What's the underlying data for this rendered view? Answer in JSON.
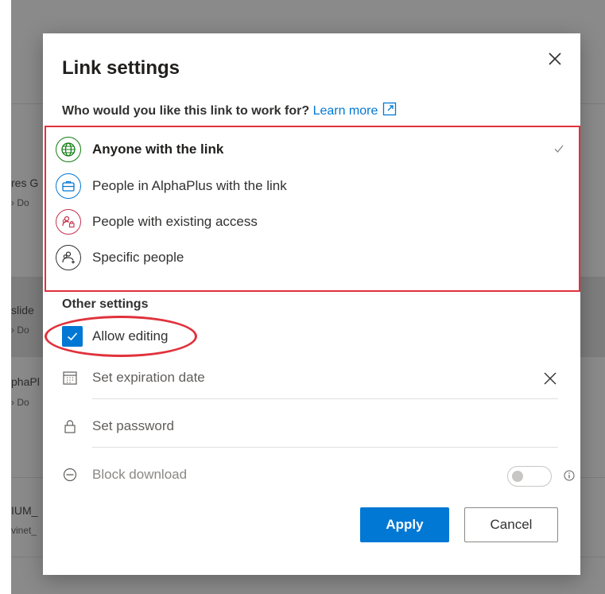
{
  "background": {
    "rows": [
      {
        "title": "res G",
        "sub": "› Do"
      },
      {
        "title": "slide",
        "sub": "› Do"
      },
      {
        "title": "phaPl",
        "sub": "› Do"
      },
      {
        "title": "IUM_",
        "sub": "vinet_"
      }
    ]
  },
  "dialog": {
    "title": "Link settings",
    "close_icon": "close-icon",
    "question": "Who would you like this link to work for?",
    "learn_more": "Learn more",
    "options": [
      {
        "label": "Anyone with the link",
        "icon": "globe-icon",
        "color": "#107c10",
        "selected": true
      },
      {
        "label": "People in AlphaPlus with the link",
        "icon": "briefcase-icon",
        "color": "#0078d4",
        "selected": false
      },
      {
        "label": "People with existing access",
        "icon": "people-lock-icon",
        "color": "#c4314b",
        "selected": false
      },
      {
        "label": "Specific people",
        "icon": "people-add-icon",
        "color": "#323130",
        "selected": false
      }
    ],
    "other_settings_heading": "Other settings",
    "allow_editing": {
      "label": "Allow editing",
      "checked": true
    },
    "expiration_placeholder": "Set expiration date",
    "password_placeholder": "Set password",
    "block_download": {
      "label": "Block download",
      "enabled": false
    },
    "apply_label": "Apply",
    "cancel_label": "Cancel"
  },
  "colors": {
    "accent": "#0078d4",
    "highlight": "#e0323c"
  }
}
